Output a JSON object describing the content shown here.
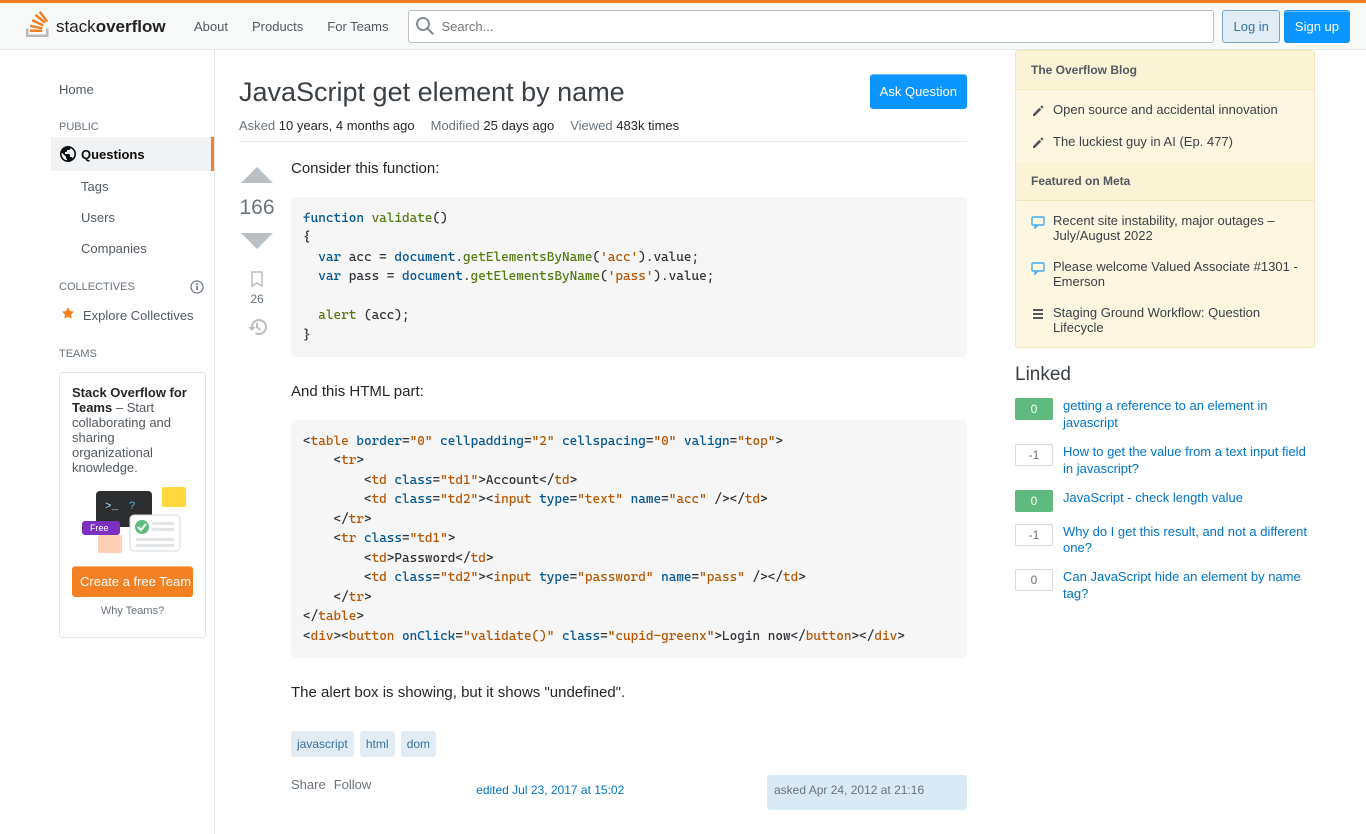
{
  "header": {
    "nav": [
      "About",
      "Products",
      "For Teams"
    ],
    "search_placeholder": "Search...",
    "login": "Log in",
    "signup": "Sign up"
  },
  "sidebar": {
    "home": "Home",
    "public": "PUBLIC",
    "questions": "Questions",
    "tags": "Tags",
    "users": "Users",
    "companies": "Companies",
    "collectives": "COLLECTIVES",
    "explore": "Explore Collectives",
    "teams": "TEAMS",
    "teams_card_strong": "Stack Overflow for Teams",
    "teams_card_text": " – Start collaborating and sharing organizational knowledge.",
    "free_tag": "Free",
    "create_team": "Create a free Team",
    "why_teams": "Why Teams?"
  },
  "question": {
    "title": "JavaScript get element by name",
    "ask_btn": "Ask Question",
    "asked_lbl": "Asked",
    "asked_val": "10 years, 4 months ago",
    "modified_lbl": "Modified",
    "modified_val": "25 days ago",
    "viewed_lbl": "Viewed",
    "viewed_val": "483k times",
    "votes": "166",
    "bookmark_count": "26",
    "body_p1": "Consider this function:",
    "body_p2": "And this HTML part:",
    "body_p3": "The alert box is showing, but it shows \"undefined\".",
    "tags": [
      "javascript",
      "html",
      "dom"
    ],
    "share": "Share",
    "follow": "Follow",
    "edited": "edited Jul 23, 2017 at 15:02",
    "asked_sig": "asked Apr 24, 2012 at 21:16"
  },
  "right": {
    "blog_h": "The Overflow Blog",
    "blog": [
      "Open source and accidental innovation",
      "The luckiest guy in AI (Ep. 477)"
    ],
    "meta_h": "Featured on Meta",
    "meta": [
      "Recent site instability, major outages – July/August 2022",
      "Please welcome Valued Associate #1301 - Emerson",
      "Staging Ground Workflow: Question Lifecycle"
    ],
    "linked_h": "Linked",
    "linked": [
      {
        "score": "0",
        "cls": "pos",
        "text": "getting a reference to an element in javascript"
      },
      {
        "score": "-1",
        "cls": "neg",
        "text": "How to get the value from a text input field in javascript?"
      },
      {
        "score": "0",
        "cls": "pos",
        "text": "JavaScript - check length value"
      },
      {
        "score": "-1",
        "cls": "neg",
        "text": "Why do I get this result, and not a different one?"
      },
      {
        "score": "0",
        "cls": "neu",
        "text": "Can JavaScript hide an element by name tag?"
      }
    ]
  }
}
